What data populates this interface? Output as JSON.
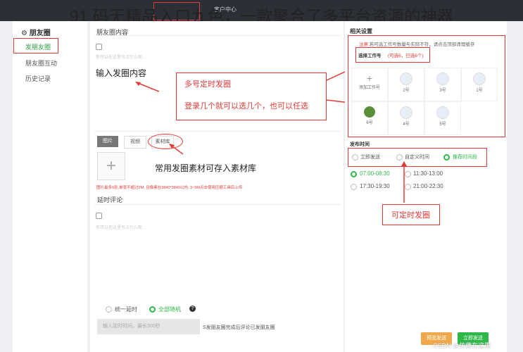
{
  "header": {
    "overlay_title": "91 码无精品入口九色，一款聚合了多平台资源的神器",
    "nav_item": "客户中心"
  },
  "sidebar": {
    "title": "朋友圈",
    "items": [
      {
        "label": "发朋友圈",
        "active": true
      },
      {
        "label": "朋友圈互动",
        "active": false
      },
      {
        "label": "历史记录",
        "active": false
      }
    ]
  },
  "main": {
    "content_label": "朋友圈内容",
    "content_placeholder": "你可以在这里写点什么呢...",
    "content_annotation": "输入发圈内容",
    "media_tabs": [
      "图片",
      "视频",
      "素材库"
    ],
    "material_annotation": "常用发圈素材可存入素材库",
    "image_hint": "图片最多9张,单张不超过2M,  且像素在3840*3840以内,  3~5M点击使用压缩工具后上传",
    "delay_comment_label": "延时评论",
    "comment_placeholder": "你可以在这里写点什么呢...",
    "delay_options": [
      "统一延时",
      "全部随机"
    ],
    "delay_input_placeholder": "输入延时时间，最长300秒",
    "delay_note": "S发朋友圈完成后评论已发朋友圈"
  },
  "callout": {
    "line1": "多号定时发圈",
    "line2": "登录几个就可以选几个，也可以任选"
  },
  "settings": {
    "title": "相关设置",
    "notice_prefix": "注意",
    "notice_text": ":若可选工作号数量与实际不符，请点击顶部清理缓存",
    "select_label": "选择工作号",
    "select_count": "(可选6，已选6个)",
    "add_label": "添加工作号",
    "accounts": [
      {
        "label": "2号"
      },
      {
        "label": "3号"
      },
      {
        "label": "1号"
      },
      {
        "label": "6号"
      },
      {
        "label": "4号"
      },
      {
        "label": "5号"
      }
    ]
  },
  "publish": {
    "title": "发布时间",
    "modes": [
      "立即发送",
      "自定义时间",
      "推荐时间段"
    ],
    "slots": [
      "07:00-08:30",
      "11:30-13:00",
      "17:30-19:30",
      "21:00-22:30"
    ],
    "annotation": "可定时发圈",
    "buttons": [
      "预览发送",
      "立即发送"
    ]
  },
  "watermark": "CSDN @仿佛在这里",
  "colors": {
    "accent": "#2eb84a",
    "annotation": "#e53935",
    "topbar": "#2c2f36"
  }
}
